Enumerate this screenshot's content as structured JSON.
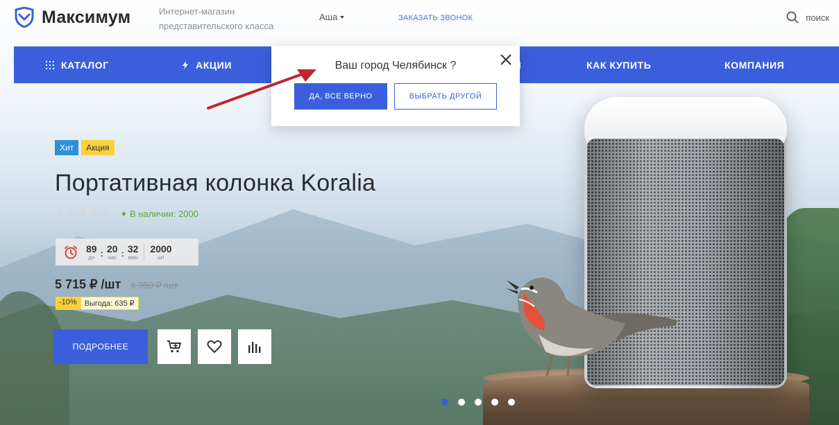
{
  "header": {
    "logo_text": "Максимум",
    "tagline_line1": "Интернет-магазин",
    "tagline_line2": "представительского класса",
    "city": "Аша",
    "callback": "ЗАКАЗАТЬ ЗВОНОК",
    "search_label": "поиск"
  },
  "nav": {
    "items": [
      {
        "label": "КАТАЛОГ",
        "icon": "grid-icon"
      },
      {
        "label": "АКЦИИ",
        "icon": "lightning-icon"
      },
      {
        "label": "I",
        "icon": ""
      },
      {
        "label": "КАК КУПИТЬ",
        "icon": ""
      },
      {
        "label": "КОМПАНИЯ",
        "icon": ""
      }
    ]
  },
  "popup": {
    "title": "Ваш город Челябинск ?",
    "confirm_label": "ДА, ВСЕ ВЕРНО",
    "other_label": "ВЫБРАТЬ ДРУГОЙ"
  },
  "product": {
    "badges": [
      "Хит",
      "Акция"
    ],
    "title": "Портативная колонка Koralia",
    "rating": 0,
    "rating_max": 5,
    "stock": "В наличии: 2000",
    "timer": {
      "days": "89",
      "days_label": "дн",
      "hours": "20",
      "hours_label": "час",
      "minutes": "32",
      "minutes_label": "мин",
      "qty": "2000",
      "qty_label": "шт"
    },
    "price": "5 715 ₽ /шт",
    "old_price": "6 350 ₽ /шт",
    "discount_pct": "-10%",
    "savings": "Выгода: 635 ₽",
    "more_label": "ПОДРОБНЕЕ"
  },
  "slider": {
    "count": 5,
    "active": 0
  },
  "colors": {
    "accent": "#3b5fdc",
    "badge_hit": "#2f8ed8",
    "badge_sale": "#f8d23a",
    "stock_green": "#5ea832",
    "arrow_red": "#c0262d"
  }
}
